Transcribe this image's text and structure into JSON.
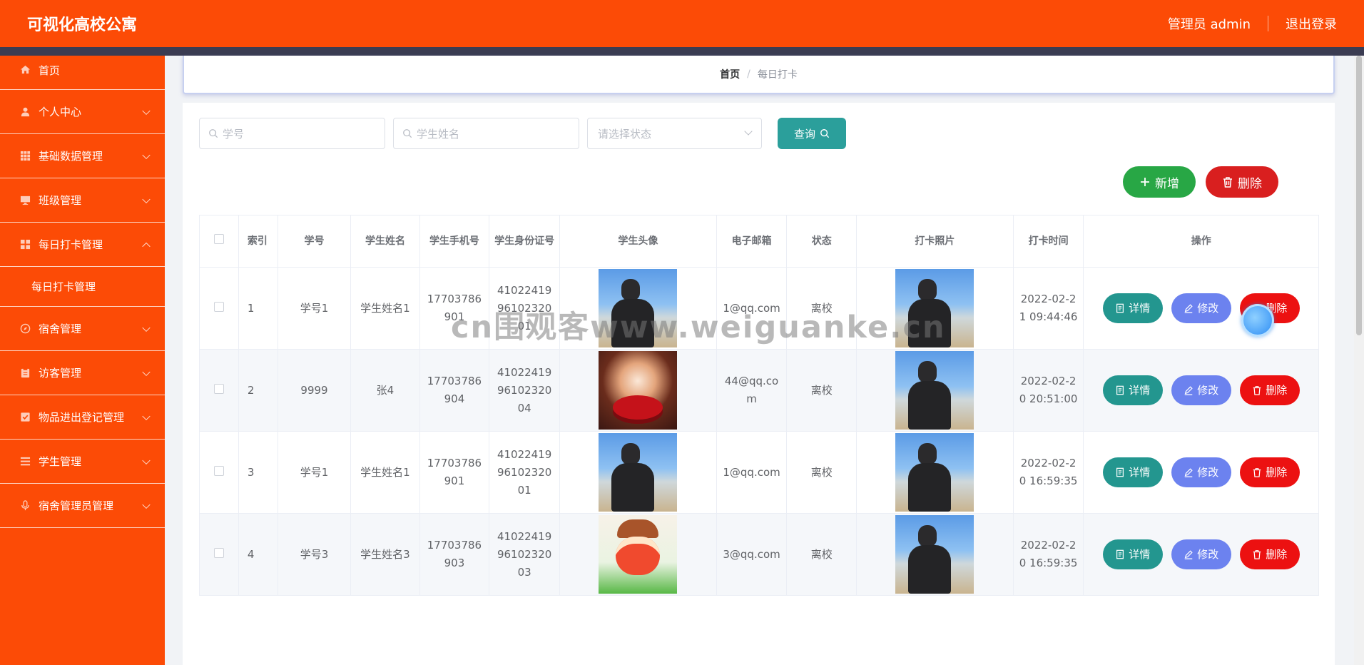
{
  "header": {
    "app_title": "可视化高校公寓",
    "user_label": "管理员 admin",
    "logout_label": "退出登录"
  },
  "sidebar": {
    "home": "首页",
    "items": [
      {
        "label": "个人中心",
        "icon": "user-icon"
      },
      {
        "label": "基础数据管理",
        "icon": "grid-icon"
      },
      {
        "label": "班级管理",
        "icon": "monitor-icon"
      },
      {
        "label": "每日打卡管理",
        "icon": "apps-icon",
        "expanded": true,
        "sub": [
          "每日打卡管理"
        ]
      },
      {
        "label": "宿舍管理",
        "icon": "compass-icon"
      },
      {
        "label": "访客管理",
        "icon": "clipboard-icon"
      },
      {
        "label": "物品进出登记管理",
        "icon": "checkbox-icon"
      },
      {
        "label": "学生管理",
        "icon": "list-icon"
      },
      {
        "label": "宿舍管理员管理",
        "icon": "mic-icon"
      }
    ]
  },
  "breadcrumb": {
    "home": "首页",
    "separator": "/",
    "current": "每日打卡"
  },
  "search": {
    "student_no_placeholder": "学号",
    "student_name_placeholder": "学生姓名",
    "status_placeholder": "请选择状态",
    "query_label": "查询"
  },
  "actions": {
    "add_label": "新增",
    "delete_label": "删除"
  },
  "table": {
    "headers": {
      "index": "索引",
      "student_no": "学号",
      "name": "学生姓名",
      "phone": "学生手机号",
      "id_card": "学生身份证号",
      "avatar": "学生头像",
      "email": "电子邮箱",
      "status": "状态",
      "photo": "打卡照片",
      "time": "打卡时间",
      "ops": "操作"
    },
    "op_labels": {
      "detail": "详情",
      "edit": "修改",
      "remove": "删除"
    },
    "rows": [
      {
        "index": "1",
        "student_no": "学号1",
        "name": "学生姓名1",
        "phone": "17703786901",
        "id_card": "410224199610232001",
        "email": "1@qq.com",
        "status": "离校",
        "time": "2022-02-21 09:44:46",
        "avatar": "person-photo"
      },
      {
        "index": "2",
        "student_no": "9999",
        "name": "张4",
        "phone": "17703786904",
        "id_card": "410224199610232004",
        "email": "44@qq.com",
        "status": "离校",
        "time": "2022-02-20 20:51:00",
        "avatar": "flower-globe-photo"
      },
      {
        "index": "3",
        "student_no": "学号1",
        "name": "学生姓名1",
        "phone": "17703786901",
        "id_card": "410224199610232001",
        "email": "1@qq.com",
        "status": "离校",
        "time": "2022-02-20 16:59:35",
        "avatar": "person-photo"
      },
      {
        "index": "4",
        "student_no": "学号3",
        "name": "学生姓名3",
        "phone": "17703786903",
        "id_card": "410224199610232003",
        "email": "3@qq.com",
        "status": "离校",
        "time": "2022-02-20 16:59:35",
        "avatar": "cartoon-photo"
      }
    ]
  },
  "watermark": "cn围观客www.weiguanke.cn",
  "colors": {
    "brand": "#fc4b06",
    "teal": "#2b9f9b",
    "green": "#28a745",
    "red": "#d91f1f",
    "blue": "#6c82ef"
  }
}
